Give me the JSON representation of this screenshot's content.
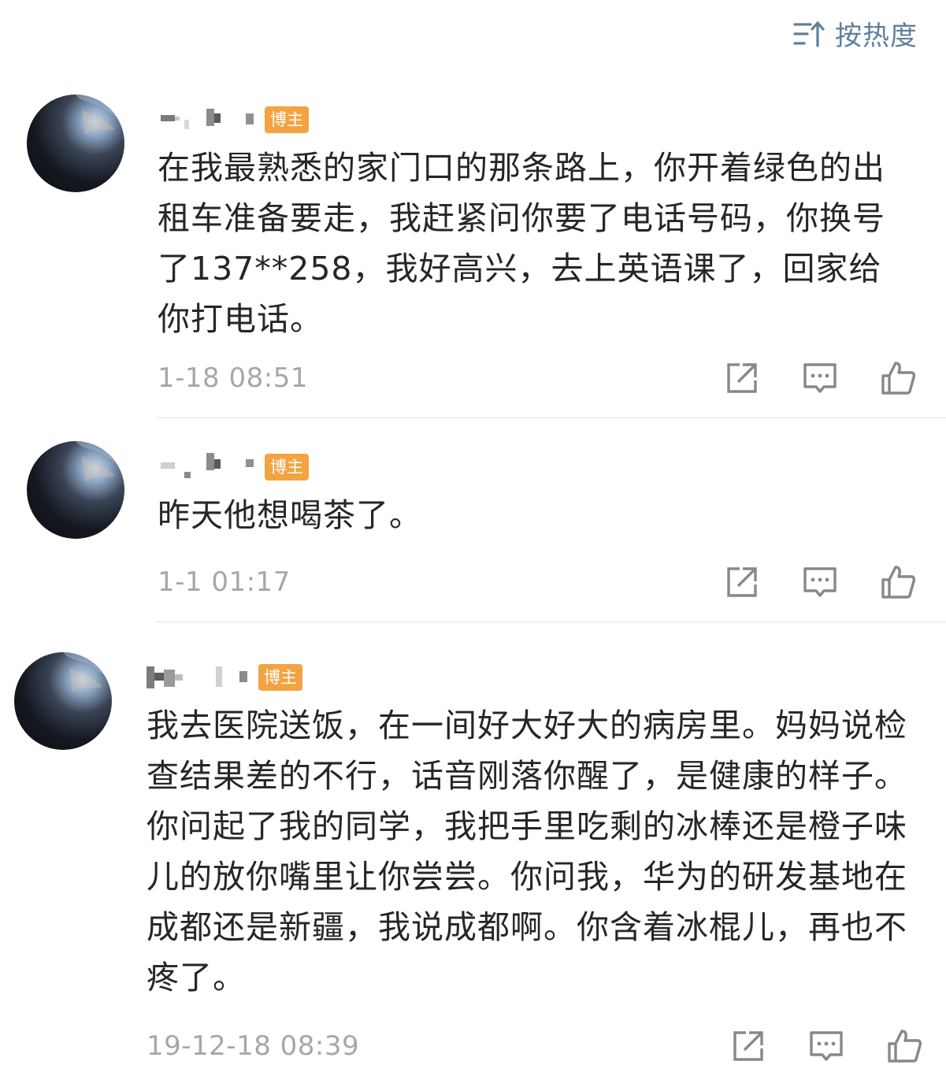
{
  "sort": {
    "label": "按热度",
    "icon": "sort-icon"
  },
  "comments": [
    {
      "badge": "博主",
      "text": "在我最熟悉的家门口的那条路上，你开着绿色的出租车准备要走，我赶紧问你要了电话号码，你换号了137**258，我好高兴，去上英语课了，回家给你打电话。",
      "time": "1-18 08:51",
      "actions": [
        "share-icon",
        "reply-icon",
        "like-icon"
      ]
    },
    {
      "badge": "博主",
      "text": "昨天他想喝茶了。",
      "time": "1-1 01:17",
      "actions": [
        "share-icon",
        "reply-icon",
        "like-icon"
      ]
    },
    {
      "badge": "博主",
      "text": "我去医院送饭，在一间好大好大的病房里。妈妈说检查结果差的不行，话音刚落你醒了，是健康的样子。你问起了我的同学，我把手里吃剩的冰棒还是橙子味儿的放你嘴里让你尝尝。你问我，华为的研发基地在成都还是新疆，我说成都啊。你含着冰棍儿，再也不疼了。",
      "time": "19-12-18 08:39",
      "actions": [
        "share-icon",
        "reply-icon",
        "like-icon"
      ]
    }
  ]
}
